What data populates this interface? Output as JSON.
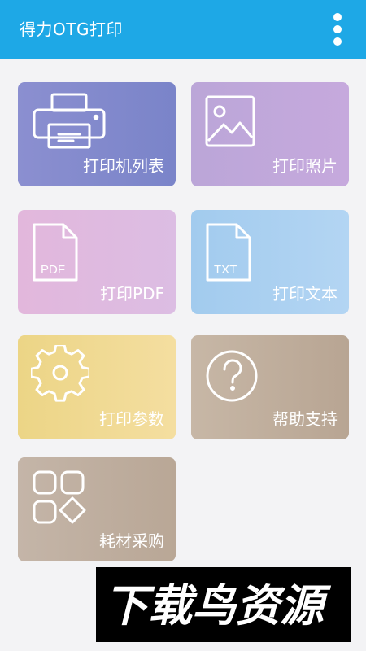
{
  "appbar": {
    "title": "得力OTG打印",
    "menu_icon": "more-vertical-icon"
  },
  "tiles": [
    {
      "id": "printers",
      "label": "打印机列表",
      "icon": "printer-icon"
    },
    {
      "id": "photo",
      "label": "打印照片",
      "icon": "image-icon"
    },
    {
      "id": "pdf",
      "label": "打印PDF",
      "icon": "pdf-file-icon",
      "icon_text": "PDF"
    },
    {
      "id": "text",
      "label": "打印文本",
      "icon": "txt-file-icon",
      "icon_text": "TXT"
    },
    {
      "id": "params",
      "label": "打印参数",
      "icon": "gear-icon"
    },
    {
      "id": "help",
      "label": "帮助支持",
      "icon": "question-circle-icon"
    },
    {
      "id": "supplies",
      "label": "耗材采购",
      "icon": "apps-grid-icon"
    }
  ],
  "watermark": {
    "text": "下载鸟资源"
  },
  "colors": {
    "appbar": "#1ea8e6",
    "printers": "#8b8fd0",
    "photo": "#c1a8da",
    "pdf": "#e0baE0",
    "text": "#a8cff0",
    "params": "#f0d993",
    "help": "#bfae9c",
    "supplies": "#bfae9f"
  }
}
